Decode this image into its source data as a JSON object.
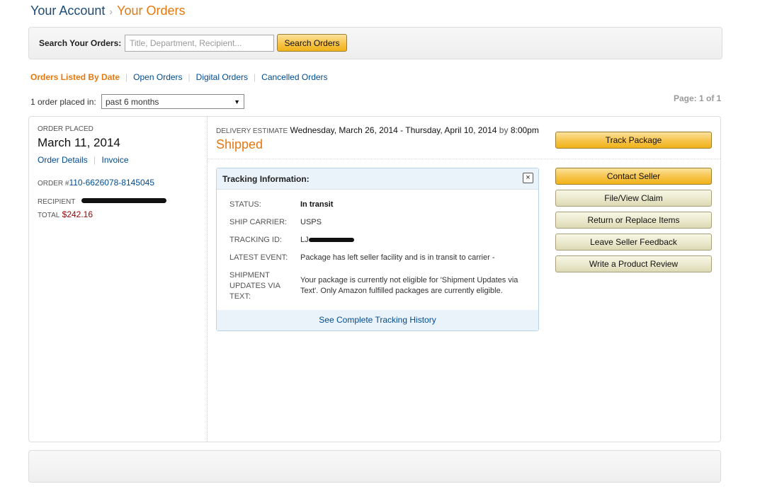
{
  "breadcrumb": {
    "account": "Your Account",
    "separator": "›",
    "orders": "Your Orders"
  },
  "search": {
    "label": "Search Your Orders:",
    "placeholder": "Title, Department, Recipient...",
    "button": "Search Orders"
  },
  "tabs": [
    {
      "label": "Orders Listed By Date",
      "active": true
    },
    {
      "label": "Open Orders"
    },
    {
      "label": "Digital Orders"
    },
    {
      "label": "Cancelled Orders"
    }
  ],
  "filter": {
    "count_text": "1 order placed in:",
    "period": "past 6 months"
  },
  "page_info": "Page: 1 of 1",
  "order": {
    "placed_label": "ORDER PLACED",
    "placed_date": "March 11, 2014",
    "details_link": "Order Details",
    "invoice_link": "Invoice",
    "number_label": "ORDER #",
    "number": "110-6626078-8145045",
    "recipient_label": "RECIPIENT",
    "total_label": "TOTAL",
    "total": "$242.16",
    "delivery_label": "DELIVERY ESTIMATE",
    "delivery_range": "Wednesday, March 26, 2014 - Thursday, April 10, 2014",
    "delivery_by": "by",
    "delivery_time": "8:00pm",
    "status": "Shipped"
  },
  "actions": [
    {
      "label": "Track Package",
      "style": "primary"
    },
    {
      "label": "Contact Seller",
      "style": "primary"
    },
    {
      "label": "File/View Claim",
      "style": "secondary"
    },
    {
      "label": "Return or Replace Items",
      "style": "secondary"
    },
    {
      "label": "Leave Seller Feedback",
      "style": "secondary"
    },
    {
      "label": "Write a Product Review",
      "style": "secondary"
    }
  ],
  "tracking": {
    "title": "Tracking Information:",
    "close_icon": "×",
    "status_label": "STATUS:",
    "status": "In transit",
    "carrier_label": "SHIP CARRIER:",
    "carrier": "USPS",
    "tracking_id_label": "TRACKING ID:",
    "tracking_id_visible": "LJ",
    "latest_event_label": "LATEST EVENT:",
    "latest_event": "Package has left seller facility and is in transit to carrier -",
    "text_updates_label": "SHIPMENT UPDATES VIA TEXT:",
    "text_updates": "Your package is currently not eligible for 'Shipment Updates via Text'. Only Amazon fulfilled packages are currently eligible.",
    "history_link": "See Complete Tracking History"
  }
}
